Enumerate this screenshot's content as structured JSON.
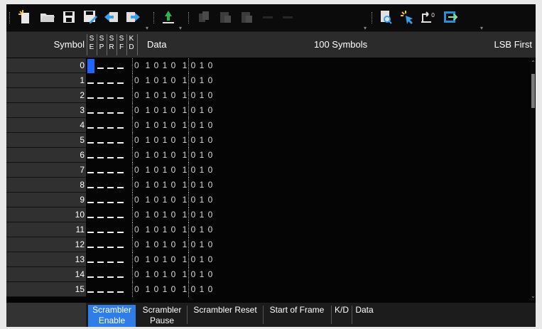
{
  "toolbar": {
    "buttons": [
      {
        "name": "new-file-icon"
      },
      {
        "name": "open-folder-icon"
      },
      {
        "name": "save-icon"
      },
      {
        "name": "save-as-icon"
      },
      {
        "name": "import-icon"
      },
      {
        "name": "export-icon"
      },
      {
        "name": "level-icon"
      },
      {
        "name": "copy-icon"
      },
      {
        "name": "paste-icon"
      },
      {
        "name": "paste-special-icon"
      },
      {
        "name": "preview-icon"
      },
      {
        "name": "select-all-icon"
      },
      {
        "name": "reset-icon"
      },
      {
        "name": "exit-icon"
      }
    ]
  },
  "header": {
    "symbol_label": "Symbol",
    "flags": [
      [
        "S",
        "E"
      ],
      [
        "S",
        "P"
      ],
      [
        "S",
        "R"
      ],
      [
        "S",
        "F"
      ],
      [
        "K",
        "D"
      ]
    ],
    "data_label": "Data",
    "count_label": "100 Symbols",
    "order_label": "LSB First"
  },
  "rows": [
    {
      "symbol": "0",
      "kd": "0",
      "bits": [
        "1",
        "0",
        "1",
        "0",
        "1",
        "0",
        "1",
        "0"
      ]
    },
    {
      "symbol": "1",
      "kd": "0",
      "bits": [
        "1",
        "0",
        "1",
        "0",
        "1",
        "0",
        "1",
        "0"
      ]
    },
    {
      "symbol": "2",
      "kd": "0",
      "bits": [
        "1",
        "0",
        "1",
        "0",
        "1",
        "0",
        "1",
        "0"
      ]
    },
    {
      "symbol": "3",
      "kd": "0",
      "bits": [
        "1",
        "0",
        "1",
        "0",
        "1",
        "0",
        "1",
        "0"
      ]
    },
    {
      "symbol": "4",
      "kd": "0",
      "bits": [
        "1",
        "0",
        "1",
        "0",
        "1",
        "0",
        "1",
        "0"
      ]
    },
    {
      "symbol": "5",
      "kd": "0",
      "bits": [
        "1",
        "0",
        "1",
        "0",
        "1",
        "0",
        "1",
        "0"
      ]
    },
    {
      "symbol": "6",
      "kd": "0",
      "bits": [
        "1",
        "0",
        "1",
        "0",
        "1",
        "0",
        "1",
        "0"
      ]
    },
    {
      "symbol": "7",
      "kd": "0",
      "bits": [
        "1",
        "0",
        "1",
        "0",
        "1",
        "0",
        "1",
        "0"
      ]
    },
    {
      "symbol": "8",
      "kd": "0",
      "bits": [
        "1",
        "0",
        "1",
        "0",
        "1",
        "0",
        "1",
        "0"
      ]
    },
    {
      "symbol": "9",
      "kd": "0",
      "bits": [
        "1",
        "0",
        "1",
        "0",
        "1",
        "0",
        "1",
        "0"
      ]
    },
    {
      "symbol": "10",
      "kd": "0",
      "bits": [
        "1",
        "0",
        "1",
        "0",
        "1",
        "0",
        "1",
        "0"
      ]
    },
    {
      "symbol": "11",
      "kd": "0",
      "bits": [
        "1",
        "0",
        "1",
        "0",
        "1",
        "0",
        "1",
        "0"
      ]
    },
    {
      "symbol": "12",
      "kd": "0",
      "bits": [
        "1",
        "0",
        "1",
        "0",
        "1",
        "0",
        "1",
        "0"
      ]
    },
    {
      "symbol": "13",
      "kd": "0",
      "bits": [
        "1",
        "0",
        "1",
        "0",
        "1",
        "0",
        "1",
        "0"
      ]
    },
    {
      "symbol": "14",
      "kd": "0",
      "bits": [
        "1",
        "0",
        "1",
        "0",
        "1",
        "0",
        "1",
        "0"
      ]
    },
    {
      "symbol": "15",
      "kd": "0",
      "bits": [
        "1",
        "0",
        "1",
        "0",
        "1",
        "0",
        "1",
        "0"
      ]
    }
  ],
  "legend": {
    "items": [
      {
        "line1": "Scrambler",
        "line2": "Enable",
        "active": true
      },
      {
        "line1": "Scrambler",
        "line2": "Pause",
        "active": false
      },
      {
        "line1": "Scrambler Reset",
        "line2": "",
        "active": false
      },
      {
        "line1": "Start of Frame",
        "line2": "",
        "active": false
      },
      {
        "line1": "K/D",
        "line2": "",
        "active": false
      },
      {
        "line1": "Data",
        "line2": "",
        "active": false
      }
    ]
  },
  "colors": {
    "selection": "#1e66ff",
    "legend_active": "#2f7ee8",
    "accent_green": "#2fb34a",
    "accent_blue": "#3aa0e8"
  }
}
